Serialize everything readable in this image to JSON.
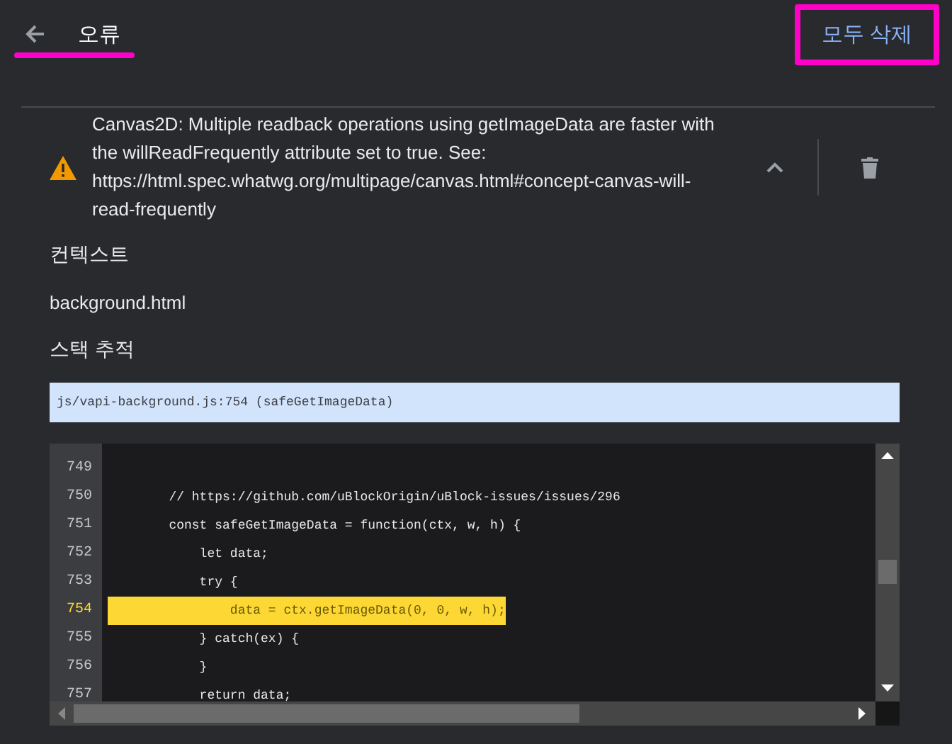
{
  "header": {
    "title": "오류",
    "clear_all_button": "모두 삭제"
  },
  "error": {
    "message": "Canvas2D: Multiple readback operations using getImageData are faster with the willReadFrequently attribute set to true. See: https://html.spec.whatwg.org/multipage/canvas.html#concept-canvas-will-read-frequently",
    "expanded": true
  },
  "context": {
    "heading": "컨텍스트",
    "value": "background.html"
  },
  "stack_trace": {
    "heading": "스택 추적",
    "frames": [
      {
        "text": "js/vapi-background.js:754 (safeGetImageData)",
        "selected": true
      }
    ]
  },
  "code": {
    "lines": [
      {
        "number": "749",
        "highlighted": false
      },
      {
        "number": "750",
        "code": "        // https://github.com/uBlockOrigin/uBlock-issues/issues/296",
        "highlighted": false
      },
      {
        "number": "751",
        "code": "        const safeGetImageData = function(ctx, w, h) {",
        "highlighted": false
      },
      {
        "number": "752",
        "code": "            let data;",
        "highlighted": false
      },
      {
        "number": "753",
        "code": "            try {",
        "highlighted": false
      },
      {
        "number": "754",
        "code": "                data = ctx.getImageData(0, 0, w, h);",
        "highlighted": true
      },
      {
        "number": "755",
        "code": "            } catch(ex) {",
        "highlighted": false
      },
      {
        "number": "756",
        "code": "            }",
        "highlighted": false
      },
      {
        "number": "757",
        "code": "            return data;",
        "highlighted": false
      }
    ]
  }
}
